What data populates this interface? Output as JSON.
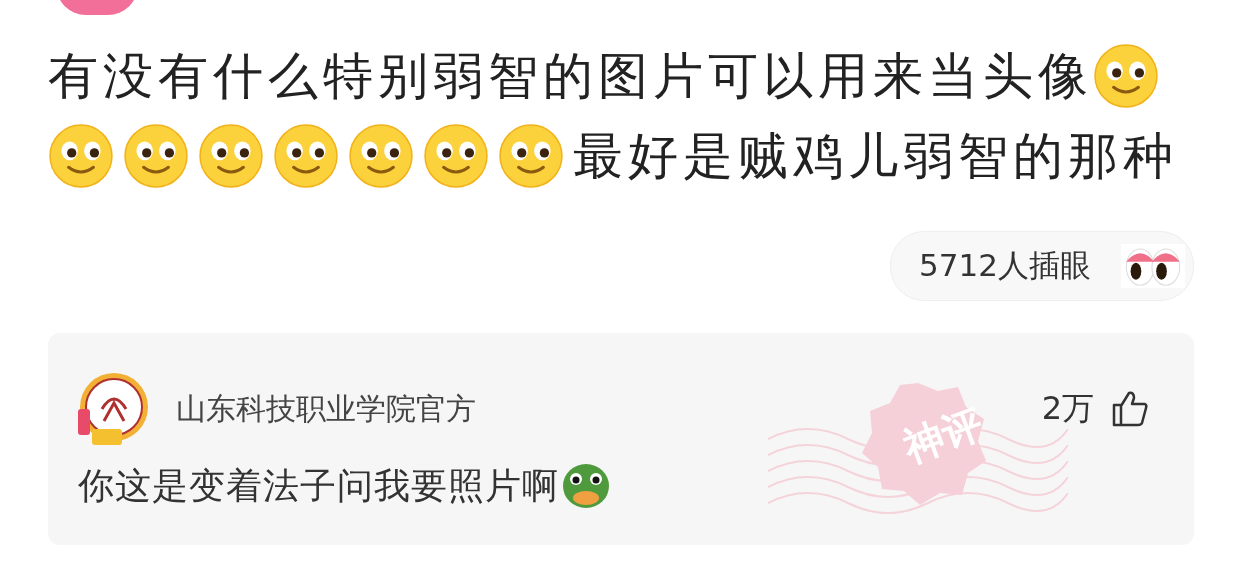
{
  "question": {
    "segments": [
      {
        "kind": "text",
        "text": "有没有什么特别弱智的图片可以用来当头像"
      },
      {
        "kind": "emoji"
      },
      {
        "kind": "emoji"
      },
      {
        "kind": "emoji"
      },
      {
        "kind": "emoji"
      },
      {
        "kind": "emoji"
      },
      {
        "kind": "emoji"
      },
      {
        "kind": "emoji"
      },
      {
        "kind": "emoji"
      },
      {
        "kind": "text",
        "text": "最好是贼鸡儿弱智的那种"
      }
    ]
  },
  "watchers": {
    "label": "5712人插眼"
  },
  "comment": {
    "author": "山东科技职业学院官方",
    "likes": "2万",
    "text": "你这是变着法子问我要照片啊",
    "stamp": "神评"
  }
}
